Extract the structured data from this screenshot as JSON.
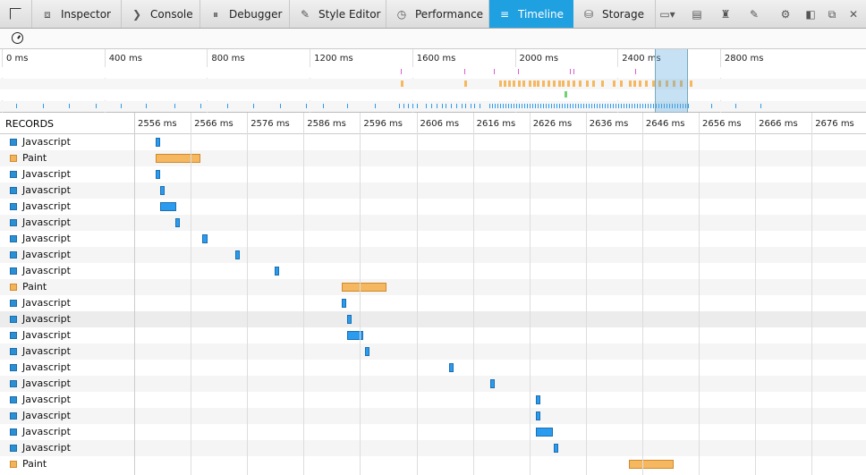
{
  "toolbar": {
    "tabs": [
      {
        "label": "Inspector",
        "icon": "inspector-icon"
      },
      {
        "label": "Console",
        "icon": "console-icon"
      },
      {
        "label": "Debugger",
        "icon": "debugger-icon"
      },
      {
        "label": "Style Editor",
        "icon": "style-editor-icon"
      },
      {
        "label": "Performance",
        "icon": "performance-icon"
      },
      {
        "label": "Timeline",
        "icon": "timeline-icon",
        "active": true
      },
      {
        "label": "Storage",
        "icon": "storage-icon"
      }
    ],
    "right_icons": [
      "responsive-mode-icon",
      "scratchpad-icon",
      "paint-flashing-icon",
      "eyedropper-icon",
      "settings-gear-icon",
      "dock-side-icon",
      "undock-icon",
      "close-icon"
    ]
  },
  "overview": {
    "ticks": [
      "0 ms",
      "400 ms",
      "800 ms",
      "1200 ms",
      "1600 ms",
      "2000 ms",
      "2400 ms",
      "2800 ms"
    ]
  },
  "records": {
    "header": "RECORDS",
    "time_labels": [
      "2556 ms",
      "2566 ms",
      "2576 ms",
      "2586 ms",
      "2596 ms",
      "2606 ms",
      "2616 ms",
      "2626 ms",
      "2636 ms",
      "2646 ms",
      "2656 ms",
      "2666 ms",
      "2676 ms"
    ],
    "rows": [
      {
        "name": "Javascript",
        "type": "js",
        "start": 2559.5,
        "end": 2560.3
      },
      {
        "name": "Paint",
        "type": "paint",
        "start": 2559.5,
        "end": 2567.4
      },
      {
        "name": "Javascript",
        "type": "js",
        "start": 2559.5,
        "end": 2560.3
      },
      {
        "name": "Javascript",
        "type": "js",
        "start": 2560.3,
        "end": 2561.1
      },
      {
        "name": "Javascript",
        "type": "js",
        "start": 2560.3,
        "end": 2563.2
      },
      {
        "name": "Javascript",
        "type": "js",
        "start": 2563.0,
        "end": 2563.8
      },
      {
        "name": "Javascript",
        "type": "js",
        "start": 2567.8,
        "end": 2568.6
      },
      {
        "name": "Javascript",
        "type": "js",
        "start": 2573.6,
        "end": 2574.4
      },
      {
        "name": "Javascript",
        "type": "js",
        "start": 2580.6,
        "end": 2581.4
      },
      {
        "name": "Paint",
        "type": "paint",
        "start": 2592.4,
        "end": 2600.4
      },
      {
        "name": "Javascript",
        "type": "js",
        "start": 2592.4,
        "end": 2593.2
      },
      {
        "name": "Javascript",
        "type": "js",
        "start": 2593.4,
        "end": 2594.2
      },
      {
        "name": "Javascript",
        "type": "js",
        "start": 2593.4,
        "end": 2596.3
      },
      {
        "name": "Javascript",
        "type": "js",
        "start": 2596.5,
        "end": 2597.3
      },
      {
        "name": "Javascript",
        "type": "js",
        "start": 2611.5,
        "end": 2612.3
      },
      {
        "name": "Javascript",
        "type": "js",
        "start": 2618.7,
        "end": 2619.5
      },
      {
        "name": "Javascript",
        "type": "js",
        "start": 2626.9,
        "end": 2627.7
      },
      {
        "name": "Javascript",
        "type": "js",
        "start": 2626.9,
        "end": 2627.7
      },
      {
        "name": "Javascript",
        "type": "js",
        "start": 2626.9,
        "end": 2629.8
      },
      {
        "name": "Javascript",
        "type": "js",
        "start": 2630.0,
        "end": 2630.8
      },
      {
        "name": "Paint",
        "type": "paint",
        "start": 2643.3,
        "end": 2651.3
      }
    ]
  },
  "colors": {
    "active_tab": "#1fa0e0",
    "javascript": "#2b9bf0",
    "paint": "#f5b860"
  }
}
